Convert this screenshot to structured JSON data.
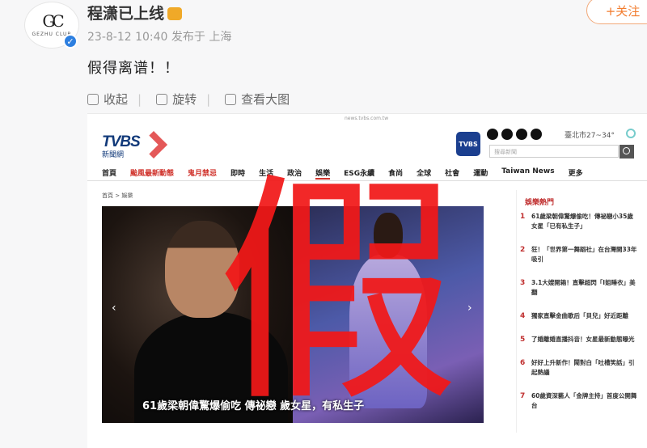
{
  "post": {
    "avatar_logo": "GC",
    "avatar_brand": "GEZHU CLUB",
    "username": "程潇已上线",
    "meta": "23-8-12 10:40 发布于 上海",
    "follow_label": "+关注",
    "text": "假得离谱！！"
  },
  "toolbar": [
    {
      "label": "收起",
      "icon": "collapse-icon"
    },
    {
      "label": "旋转",
      "icon": "rotate-icon"
    },
    {
      "label": "查看大图",
      "icon": "view-image-icon"
    }
  ],
  "news": {
    "url": "news.tvbs.com.tw",
    "logo": "TVBS",
    "logo_sub": "新聞網",
    "app_badge": "TVBS",
    "weather": "臺北市27~34°",
    "search_placeholder": "搜尋新聞",
    "nav": [
      "首頁",
      "颱風最新動態",
      "鬼月禁忌",
      "即時",
      "生活",
      "政治",
      "娛樂",
      "ESG永續",
      "食尚",
      "全球",
      "社會",
      "運動",
      "Taiwan News",
      "更多"
    ],
    "breadcrumb": "首頁 > 娛樂",
    "caption": "61歲梁朝偉驚爆偷吃 傳祕戀 歲女星，有私生子",
    "stamp": "假",
    "sidebar_title": "娛樂熱門",
    "sidebar_items": [
      "61歲梁朝偉驚爆偷吃！傳祕戀小35歲女星「已有私生子」",
      "狂！「世界第一舞蹈社」在台灣開33年吸引",
      "3.1大嫂開箱！直擊超閃「I姐睡衣」美翻",
      "獨家直擊金曲歌后「貝兒」好近距離",
      "了婚離婚直播抖音！女星最新動態曝光",
      "好好上升新作！鬧對白「吐槽笑話」引起熱議",
      "60歲資深藝人「金牌主持」首度公開舞台"
    ]
  }
}
